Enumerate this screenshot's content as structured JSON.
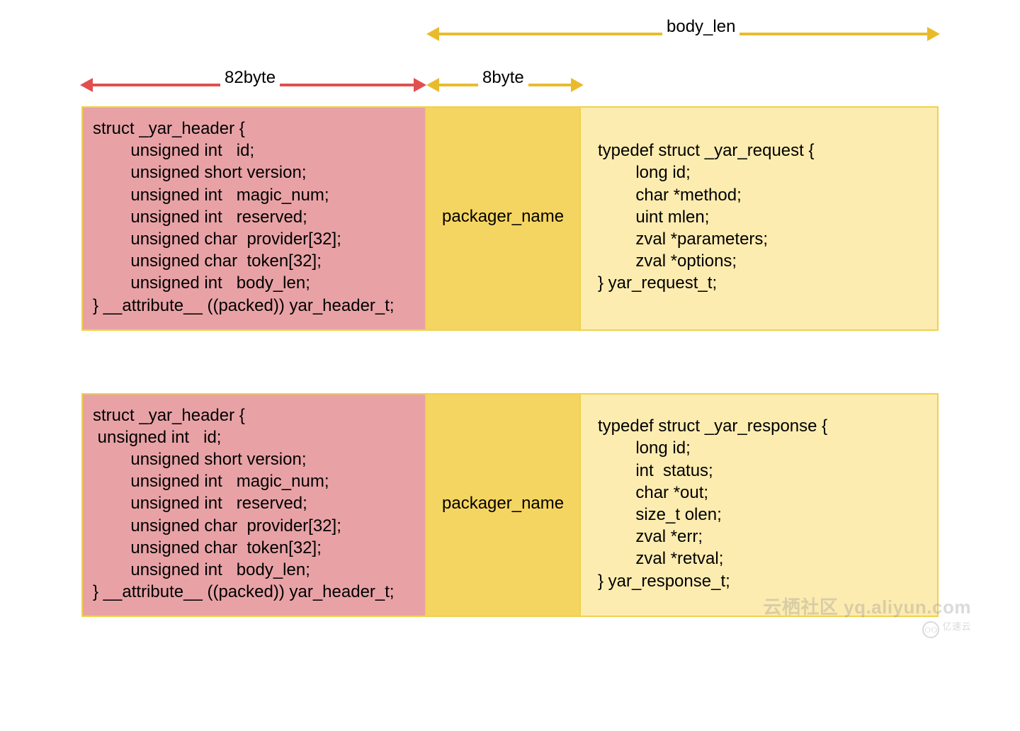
{
  "arrows": {
    "body_len_label": "body_len",
    "size_82_label": "82byte",
    "size_8_label": "8byte"
  },
  "colors": {
    "pink": "#e8a2a6",
    "gold": "#f5d561",
    "cream": "#fdecb0",
    "border": "#f0d24a",
    "red": "#e24f4f",
    "yellow": "#e9bb2c"
  },
  "request": {
    "header": "struct _yar_header {\n        unsigned int   id;\n        unsigned short version;\n        unsigned int   magic_num;\n        unsigned int   reserved;\n        unsigned char  provider[32];\n        unsigned char  token[32];\n        unsigned int   body_len;\n} __attribute__ ((packed)) yar_header_t;",
    "packager": "packager_name",
    "body": "typedef struct _yar_request {\n        long id;\n        char *method;\n        uint mlen;\n        zval *parameters;\n        zval *options;\n} yar_request_t;"
  },
  "response": {
    "header": "struct _yar_header {\n unsigned int   id;\n        unsigned short version;\n        unsigned int   magic_num;\n        unsigned int   reserved;\n        unsigned char  provider[32];\n        unsigned char  token[32];\n        unsigned int   body_len;\n} __attribute__ ((packed)) yar_header_t;",
    "packager": "packager_name",
    "body": "typedef struct _yar_response {\n        long id;\n        int  status;\n        char *out;\n        size_t olen;\n        zval *err;\n        zval *retval;\n} yar_response_t;"
  },
  "watermark": {
    "line1": "云栖社区 yq.aliyun.com",
    "line2": "亿速云"
  }
}
